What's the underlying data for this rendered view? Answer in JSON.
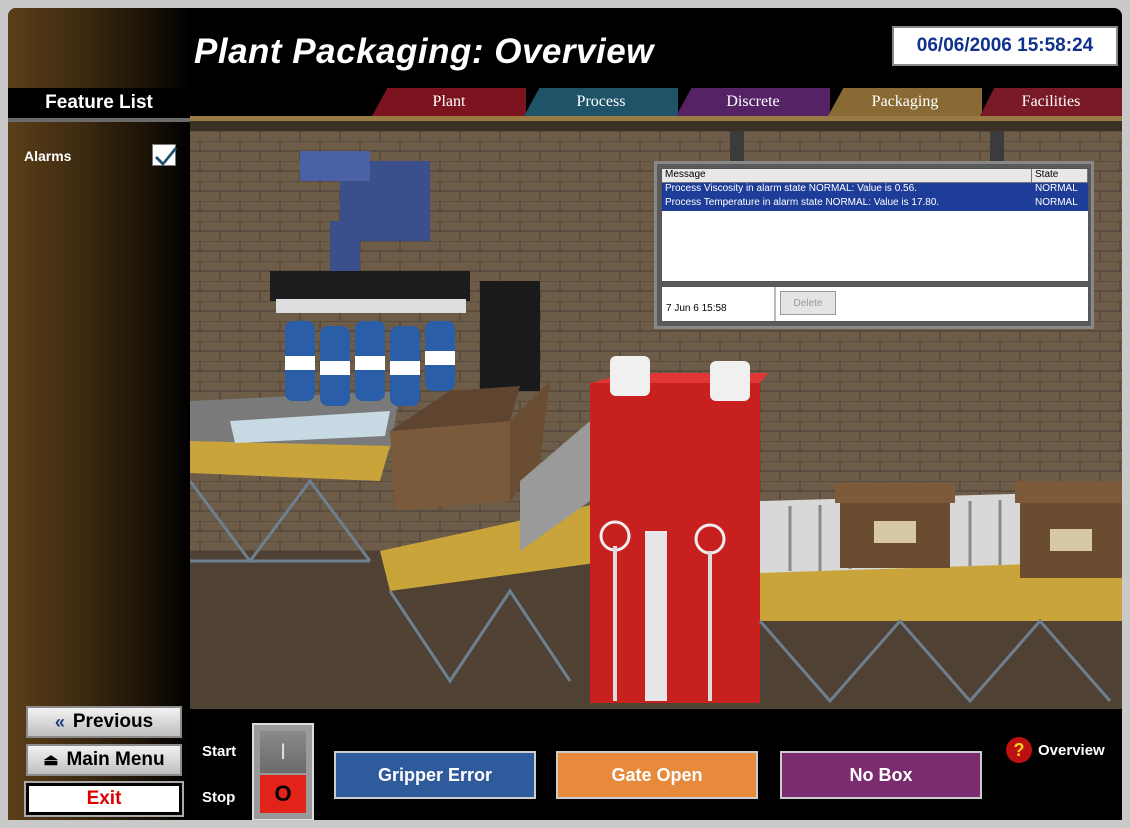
{
  "header": {
    "title": "Plant Packaging: Overview",
    "datetime": "06/06/2006 15:58:24"
  },
  "sidebar": {
    "title": "Feature List",
    "alarms_label": "Alarms",
    "alarms_checked": true,
    "previous_label": "Previous",
    "main_menu_label": "Main Menu",
    "exit_label": "Exit"
  },
  "tabs": [
    {
      "label": "Plant",
      "color": "#7c1420"
    },
    {
      "label": "Process",
      "color": "#1f5368"
    },
    {
      "label": "Discrete",
      "color": "#552266"
    },
    {
      "label": "Packaging",
      "color": "#8a6a34",
      "active": true
    },
    {
      "label": "Facilities",
      "color": "#7a1a26"
    }
  ],
  "alarms": {
    "columns": [
      "Message",
      "State"
    ],
    "rows": [
      {
        "message": "Process Viscosity in alarm state NORMAL: Value is 0.56.",
        "state": "NORMAL"
      },
      {
        "message": "Process Temperature in alarm state NORMAL: Value is 17.80.",
        "state": "NORMAL"
      }
    ],
    "timestamp": "7 Jun 6 15:58",
    "delete_label": "Delete"
  },
  "controls": {
    "start_label": "Start",
    "stop_label": "Stop",
    "switch_on_glyph": "I",
    "switch_off_glyph": "O",
    "gripper_label": "Gripper Error",
    "gate_label": "Gate Open",
    "nobox_label": "No Box",
    "help_label": "Overview"
  }
}
